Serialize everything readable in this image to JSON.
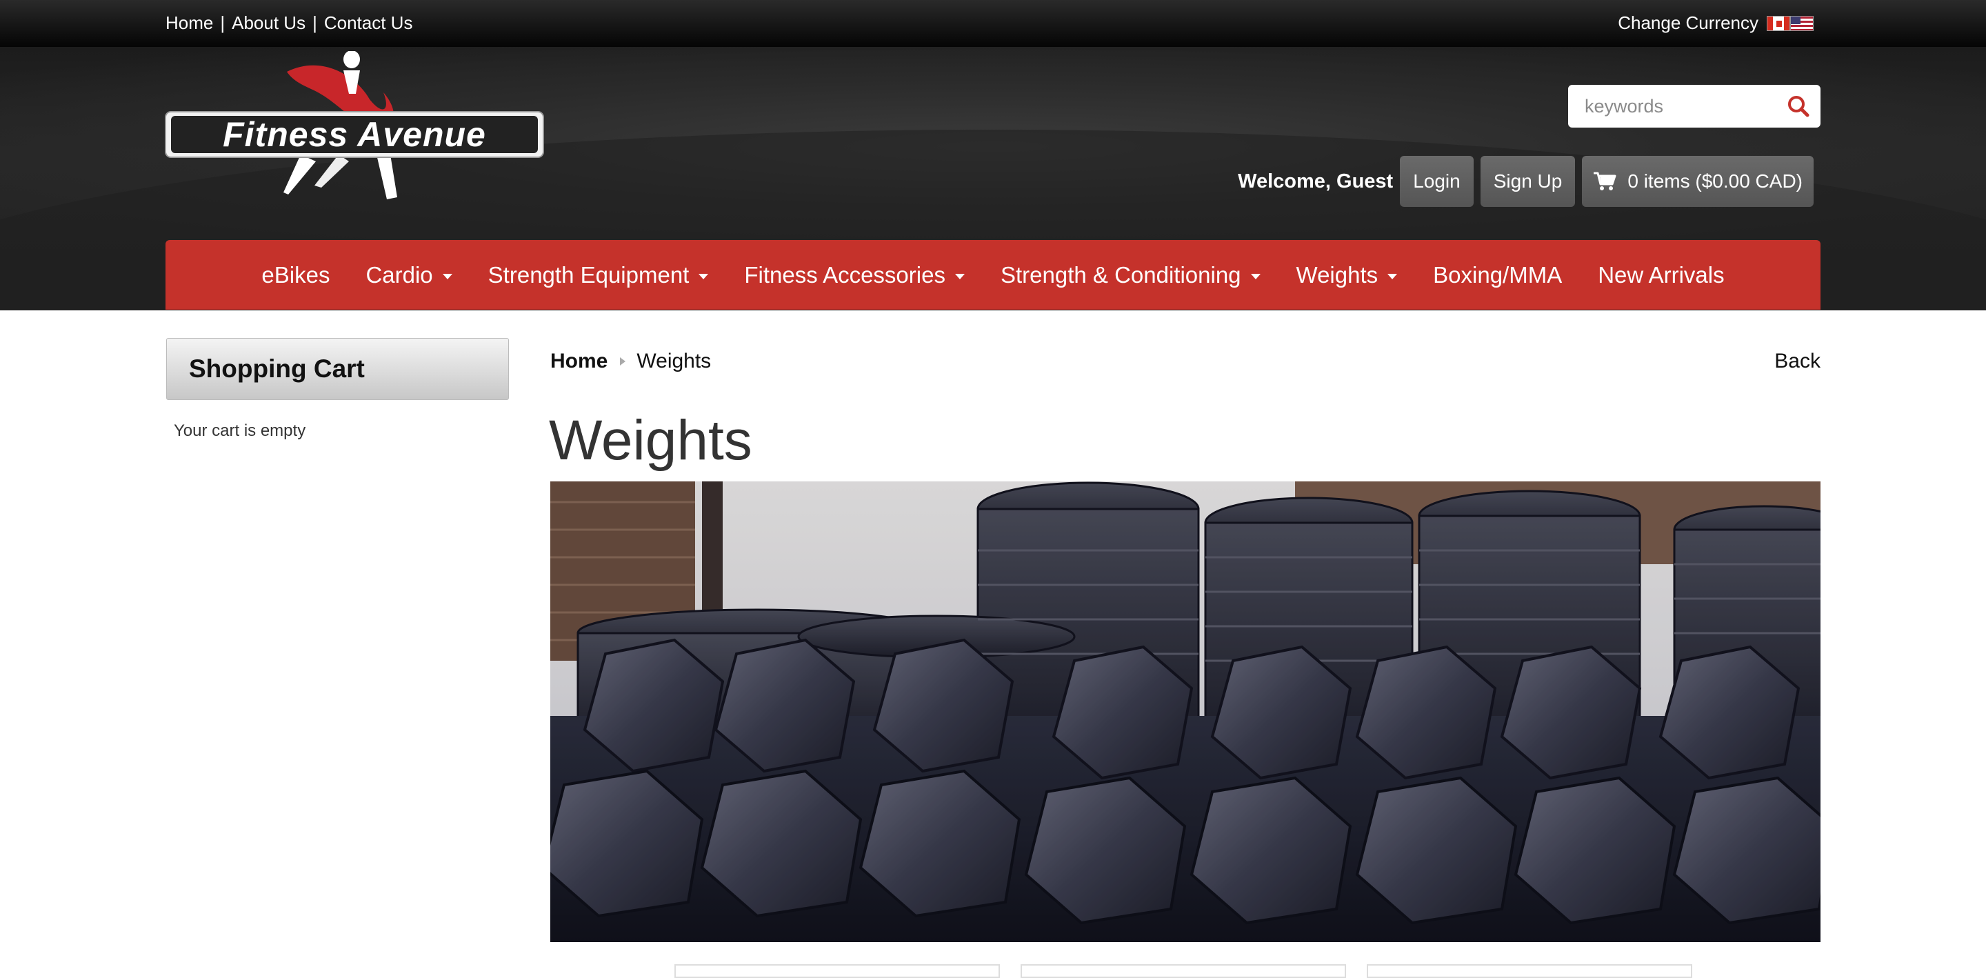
{
  "topbar": {
    "links": [
      "Home",
      "About Us",
      "Contact Us"
    ],
    "separator": "|",
    "currency_label": "Change Currency",
    "currency_flags": [
      "canada-flag-icon",
      "usa-flag-icon"
    ]
  },
  "header": {
    "logo_text": "Fitness Avenue",
    "search_placeholder": "keywords",
    "welcome_text": "Welcome, Guest",
    "login_label": "Login",
    "signup_label": "Sign Up",
    "cart_label": "0 items ($0.00 CAD)"
  },
  "nav": {
    "items": [
      {
        "label": "eBikes",
        "dropdown": false
      },
      {
        "label": "Cardio",
        "dropdown": true
      },
      {
        "label": "Strength Equipment",
        "dropdown": true
      },
      {
        "label": "Fitness Accessories",
        "dropdown": true
      },
      {
        "label": "Strength & Conditioning",
        "dropdown": true
      },
      {
        "label": "Weights",
        "dropdown": true
      },
      {
        "label": "Boxing/MMA",
        "dropdown": false
      },
      {
        "label": "New Arrivals",
        "dropdown": false
      }
    ]
  },
  "sidebar": {
    "cart_title": "Shopping Cart",
    "cart_empty_text": "Your cart is empty"
  },
  "main": {
    "breadcrumb": {
      "home": "Home",
      "current": "Weights"
    },
    "back_label": "Back",
    "page_title": "Weights",
    "banner_alt": "rows of hexagonal dumbbells and stacked weight plates"
  },
  "colors": {
    "nav_red": "#c5322b",
    "topbar_black": "#050505",
    "header_dark": "#222222",
    "button_gray": "#5c5c5c"
  }
}
